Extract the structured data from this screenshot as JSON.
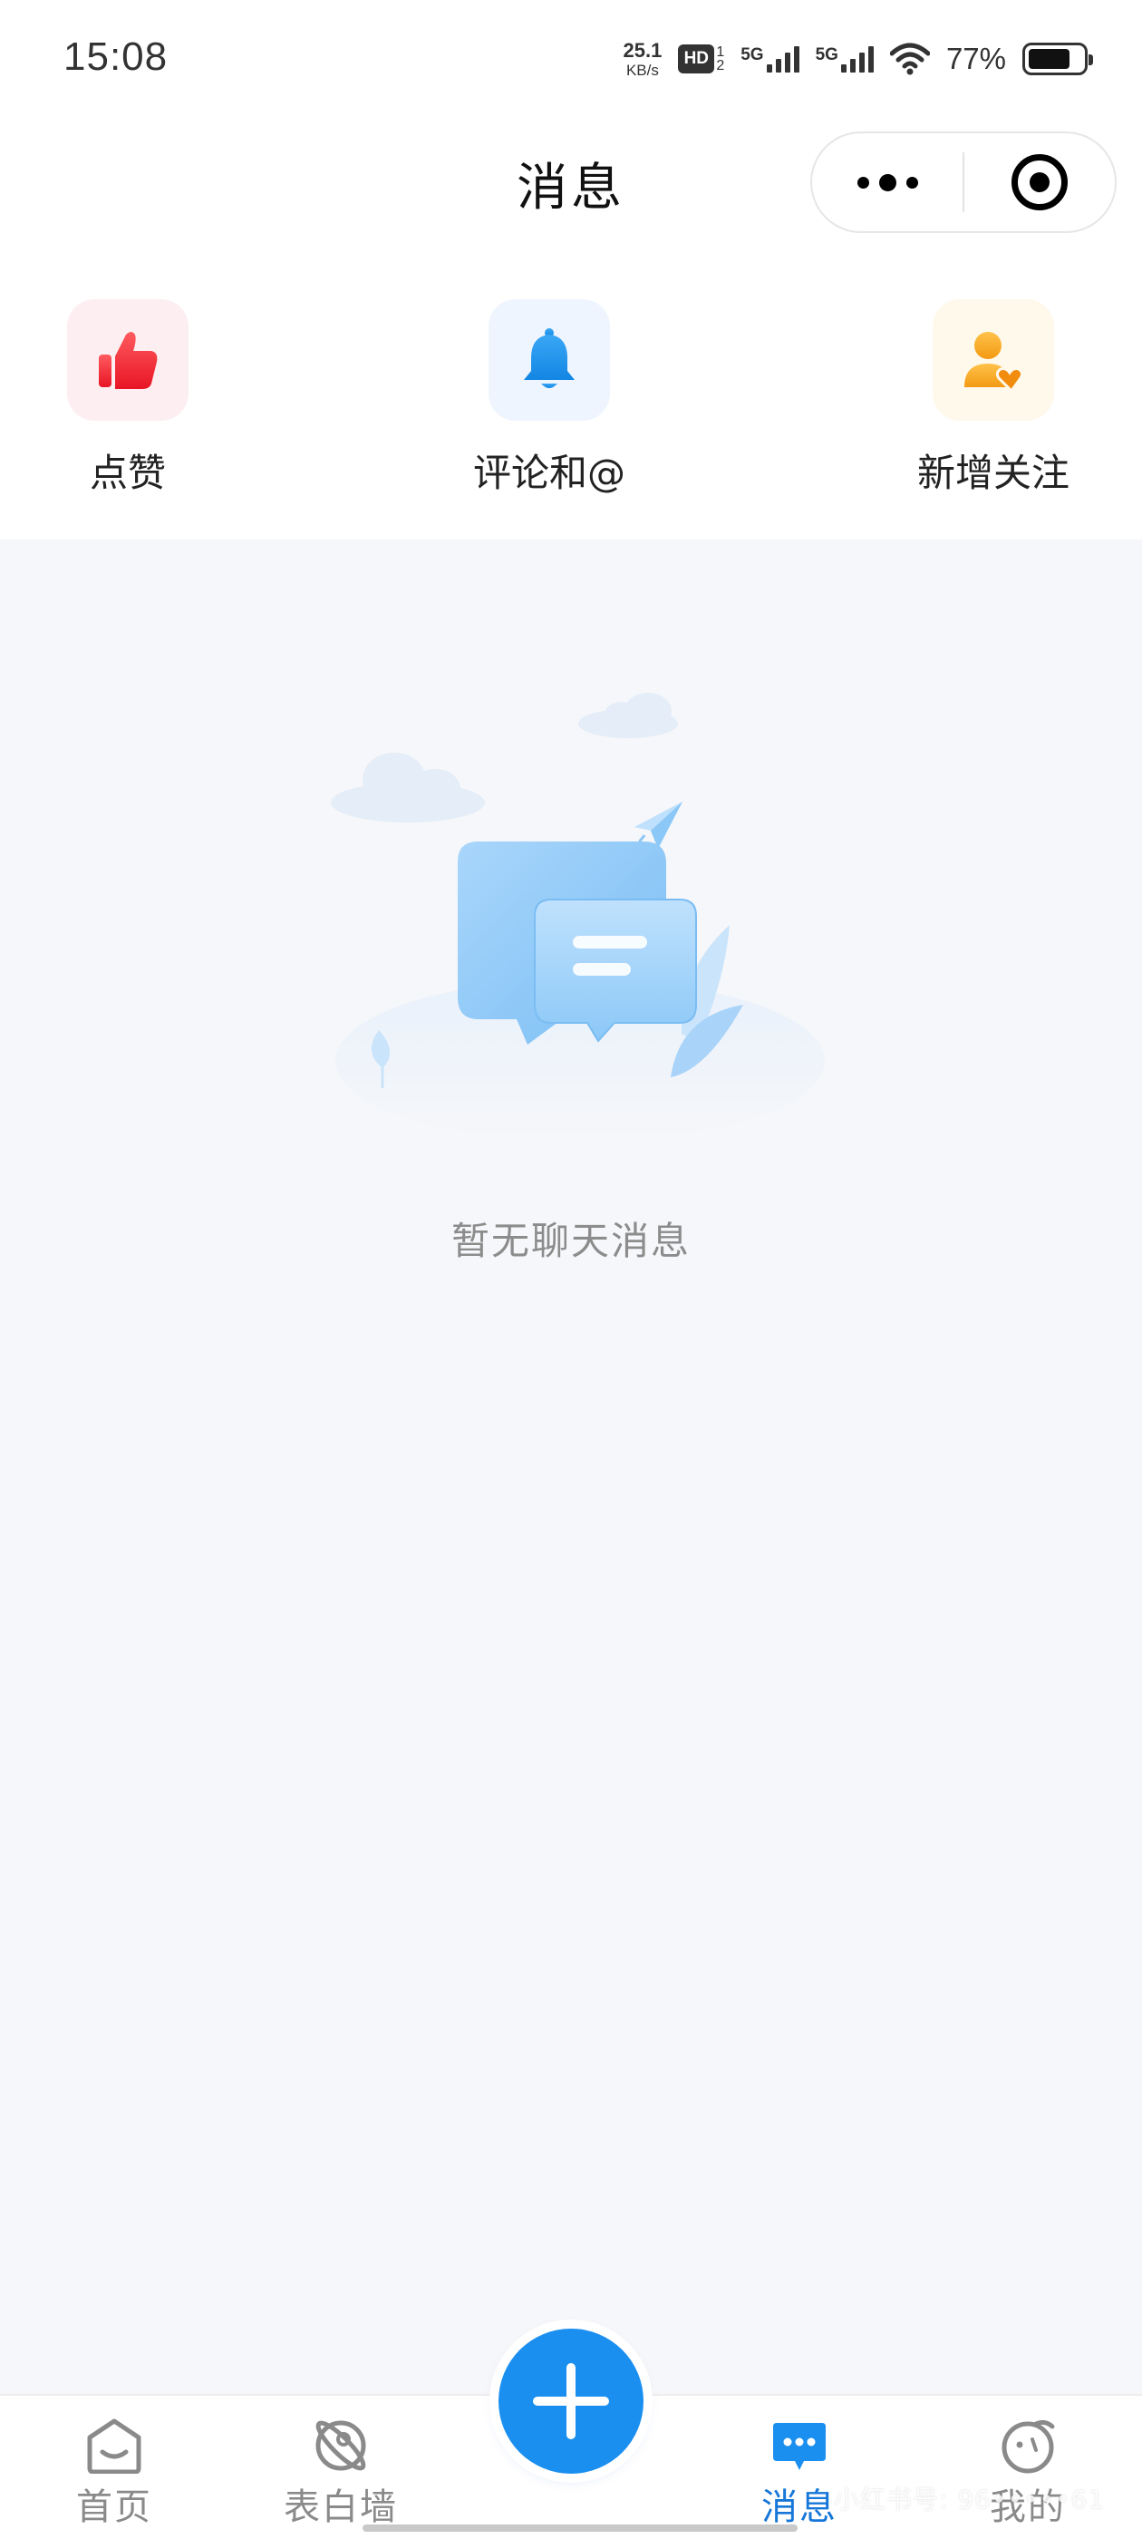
{
  "status_bar": {
    "time": "15:08",
    "net_speed_value": "25.1",
    "net_speed_unit": "KB/s",
    "hd_label": "HD",
    "hd_sup": "1",
    "hd_sub": "2",
    "signal_1_label": "5G",
    "signal_2_label": "5G",
    "battery_percent": "77%",
    "battery_level": 0.77
  },
  "header": {
    "title": "消息",
    "more_icon": "more-dots-icon",
    "close_icon": "target-circle-icon"
  },
  "quick_entries": [
    {
      "label": "点赞",
      "icon": "thumbs-up-icon",
      "bg": "#fdeff1",
      "color": "#f2333f"
    },
    {
      "label": "评论和@",
      "icon": "bell-icon",
      "bg": "#eef5fe",
      "color": "#1e93ec"
    },
    {
      "label": "新增关注",
      "icon": "user-heart-icon",
      "bg": "#fff9ec",
      "color": "#f6a623"
    }
  ],
  "empty_state": {
    "icon": "chat-bubbles-illustration",
    "text": "暂无聊天消息"
  },
  "tab_bar": {
    "items": [
      {
        "label": "首页",
        "icon": "home-icon",
        "active": false
      },
      {
        "label": "表白墙",
        "icon": "planet-icon",
        "active": false
      },
      {
        "label": "消息",
        "icon": "message-icon",
        "active": true
      },
      {
        "label": "我的",
        "icon": "profile-icon",
        "active": false
      }
    ],
    "fab_icon": "plus-icon"
  },
  "watermark": "小红书号: 96•••••61",
  "colors": {
    "accent": "#1a8ff0",
    "active_tab": "#1677d8",
    "page_bg": "#f6f7fa"
  }
}
